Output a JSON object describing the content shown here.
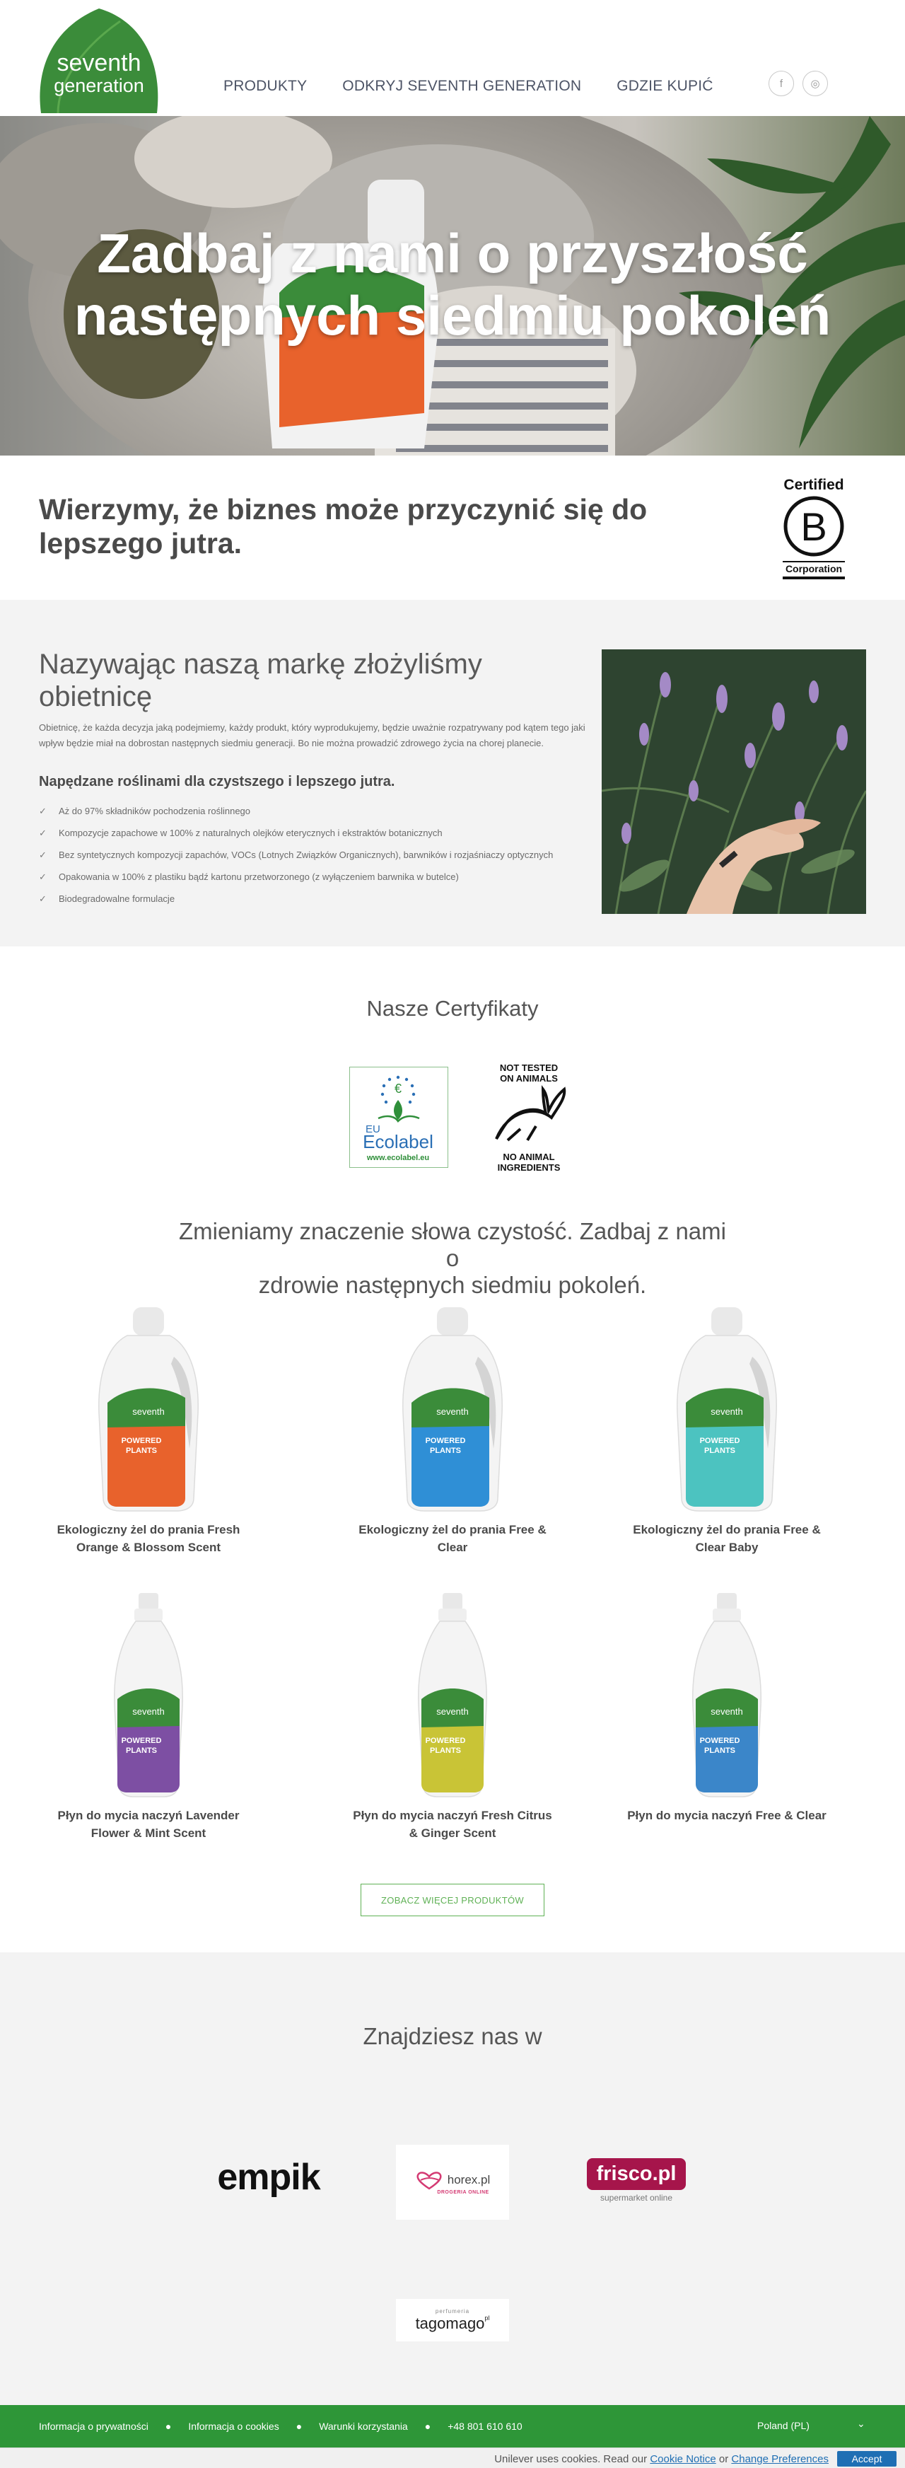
{
  "brand": {
    "logo_line1": "seventh",
    "logo_line2": "generation",
    "logo_color": "#3b8c3a"
  },
  "nav": {
    "items": [
      "PRODUKTY",
      "ODKRYJ SEVENTH GENERATION",
      "GDZIE KUPIĆ"
    ]
  },
  "social": {
    "icons": [
      "facebook-icon",
      "instagram-icon"
    ],
    "facebook_glyph": "f",
    "instagram_glyph": "◎"
  },
  "hero": {
    "title_line1": "Zadbaj z nami o przyszłość",
    "title_line2": "następnych siedmiu pokoleń"
  },
  "belief": {
    "title_line1": "Wierzymy, że biznes może przyczynić się do",
    "title_line2": "lepszego jutra.",
    "bcorp_top": "Certified",
    "bcorp_letter": "B",
    "bcorp_bottom": "Corporation"
  },
  "promise": {
    "title_line1": "Nazywając naszą markę złożyliśmy",
    "title_line2": "obietnicę",
    "text": "Obietnicę, że każda decyzja jaką podejmiemy, każdy produkt, który wyprodukujemy, będzie uważnie rozpatrywany pod kątem tego jaki wpływ będzie miał na dobrostan następnych siedmiu generacji. Bo nie można prowadzić zdrowego życia na chorej planecie.",
    "subtitle": "Napędzane roślinami dla czystszego i lepszego jutra.",
    "checklist": [
      "Aż do 97% składników pochodzenia roślinnego",
      "Kompozycje zapachowe w 100% z naturalnych olejków eterycznych i ekstraktów botanicznych",
      "Bez syntetycznych kompozycji zapachów, VOCs (Lotnych Związków Organicznych), barwników i rozjaśniaczy optycznych",
      "Opakowania w 100% z plastiku bądź kartonu przetworzonego (z wyłączeniem barwnika w butelce)",
      "Biodegradowalne formulacje"
    ]
  },
  "certificates": {
    "title": "Nasze Certyfikaty",
    "ecolabel": {
      "eu": "EU",
      "name": "Ecolabel",
      "url": "www.ecolabel.eu"
    },
    "not_tested": {
      "top1": "NOT TESTED",
      "top2": "ON ANIMALS",
      "bottom1": "NO ANIMAL",
      "bottom2": "INGREDIENTS"
    }
  },
  "tagline": {
    "line1": "Zmieniamy znaczenie słowa czystość. Zadbaj z nami o",
    "line2": "zdrowie następnych siedmiu pokoleń."
  },
  "products": [
    {
      "name_line1": "Ekologiczny żel do prania Fresh",
      "name_line2": "Orange & Blossom Scent",
      "accent": "#e8622c",
      "kind": "laundry"
    },
    {
      "name_line1": "Ekologiczny żel do prania Free &",
      "name_line2": "Clear",
      "accent": "#2f8fd6",
      "kind": "laundry"
    },
    {
      "name_line1": "Ekologiczny żel do prania Free &",
      "name_line2": "Clear Baby",
      "accent": "#4cc3c0",
      "kind": "laundry"
    },
    {
      "name_line1": "Płyn do mycia naczyń Lavender",
      "name_line2": "Flower & Mint Scent",
      "accent": "#7d4fa3",
      "kind": "dish"
    },
    {
      "name_line1": "Płyn do mycia naczyń Fresh Citrus",
      "name_line2": "& Ginger Scent",
      "accent": "#c9c436",
      "kind": "dish"
    },
    {
      "name_line1": "Płyn do mycia naczyń Free & Clear",
      "name_line2": "",
      "accent": "#3b86c9",
      "kind": "dish"
    }
  ],
  "label_text": {
    "brand_small": "seventh",
    "powered": "POWERED",
    "plants": "PLANTS"
  },
  "more_button": "ZOBACZ WIĘCEJ PRODUKTÓW",
  "findus": {
    "title": "Znajdziesz nas w",
    "empik": "empik",
    "horex": "horex.pl",
    "horex_sub": "DROGERIA ONLINE",
    "frisco": "frisco.pl",
    "frisco_sub": "supermarket online",
    "tago_top": "perfumeria",
    "tago": "tagomago",
    "tago_sup": "pl"
  },
  "footer": {
    "links": [
      "Informacja o prywatności",
      "Informacja o cookies",
      "Warunki korzystania",
      "+48 801 610 610"
    ],
    "country": "Poland (PL)",
    "chevron": "⌄"
  },
  "cookie": {
    "text_before": "Unilever uses cookies. Read our",
    "link1": "Cookie Notice",
    "middle": "or",
    "link2": "Change Preferences",
    "accept": "Accept"
  }
}
